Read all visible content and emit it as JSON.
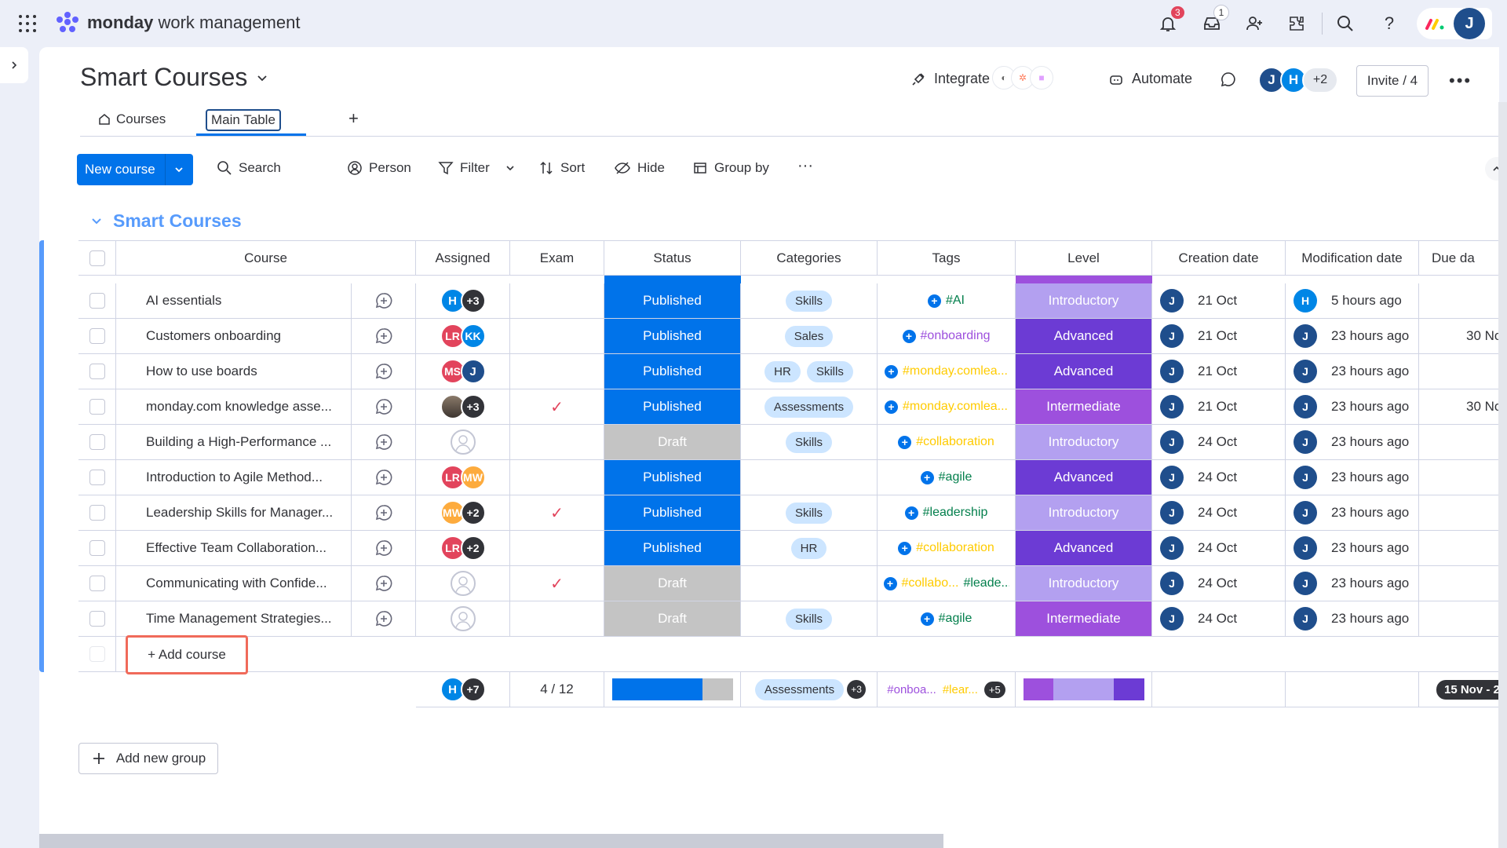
{
  "topbar": {
    "brand_bold": "monday",
    "brand_rest": " work management",
    "notifications_count": "3",
    "inbox_count": "1",
    "user_initial": "J"
  },
  "board": {
    "title": "Smart Courses",
    "integrate_label": "Integrate",
    "automate_label": "Automate",
    "invite_label": "Invite / 4",
    "members_more": "+2",
    "member_j": "J",
    "member_h": "H"
  },
  "tabs": {
    "courses": "Courses",
    "main_table": "Main Table",
    "add": "+"
  },
  "toolbar": {
    "new_course": "New course",
    "search": "Search",
    "person": "Person",
    "filter": "Filter",
    "sort": "Sort",
    "hide": "Hide",
    "group_by": "Group by",
    "more": "···"
  },
  "group": {
    "title": "Smart Courses"
  },
  "columns": {
    "course": "Course",
    "assigned": "Assigned",
    "exam": "Exam",
    "status": "Status",
    "categories": "Categories",
    "tags": "Tags",
    "level": "Level",
    "creation_date": "Creation date",
    "modification_date": "Modification date",
    "due_date": "Due da"
  },
  "colors": {
    "published": "#0073ea",
    "draft": "#c4c4c4",
    "introductory": "#b3a0f0",
    "advanced": "#6c3bd4",
    "intermediate": "#9d50dd",
    "group_blue": "#579bfc"
  },
  "rows": [
    {
      "course": "AI essentials",
      "assigned": [
        "H",
        "+3"
      ],
      "exam": "",
      "status": "Published",
      "categories": [
        "Skills"
      ],
      "tags": [
        "#AI"
      ],
      "tag_color": "#037f4c",
      "level": "Introductory",
      "created": "21 Oct",
      "mod_user": "H",
      "modified": "5 hours ago",
      "due": ""
    },
    {
      "course": "Customers onboarding",
      "assigned": [
        "LR",
        "KK"
      ],
      "exam": "",
      "status": "Published",
      "categories": [
        "Sales"
      ],
      "tags": [
        "#onboarding"
      ],
      "tag_color": "#9d50dd",
      "level": "Advanced",
      "created": "21 Oct",
      "mod_user": "J",
      "modified": "23 hours ago",
      "due": "30 No"
    },
    {
      "course": "How to use boards",
      "assigned": [
        "MS",
        "J"
      ],
      "exam": "",
      "status": "Published",
      "categories": [
        "HR",
        "Skills"
      ],
      "tags": [
        "#monday.comlea..."
      ],
      "tag_color": "#ffcb00",
      "level": "Advanced",
      "created": "21 Oct",
      "mod_user": "J",
      "modified": "23 hours ago",
      "due": ""
    },
    {
      "course": "monday.com knowledge asse...",
      "assigned": [
        "photo",
        "+3"
      ],
      "exam": "✓",
      "status": "Published",
      "categories": [
        "Assessments"
      ],
      "tags": [
        "#monday.comlea..."
      ],
      "tag_color": "#ffcb00",
      "level": "Intermediate",
      "created": "21 Oct",
      "mod_user": "J",
      "modified": "23 hours ago",
      "due": "30 No"
    },
    {
      "course": "Building a High-Performance ...",
      "assigned": [],
      "exam": "",
      "status": "Draft",
      "categories": [
        "Skills"
      ],
      "tags": [
        "#collaboration"
      ],
      "tag_color": "#ffcb00",
      "level": "Introductory",
      "created": "24 Oct",
      "mod_user": "J",
      "modified": "23 hours ago",
      "due": ""
    },
    {
      "course": "Introduction to Agile Method...",
      "assigned": [
        "LR",
        "MW"
      ],
      "exam": "",
      "status": "Published",
      "categories": [],
      "tags": [
        "#agile"
      ],
      "tag_color": "#037f4c",
      "level": "Advanced",
      "created": "24 Oct",
      "mod_user": "J",
      "modified": "23 hours ago",
      "due": ""
    },
    {
      "course": "Leadership Skills for Manager...",
      "assigned": [
        "MW",
        "+2"
      ],
      "exam": "✓",
      "status": "Published",
      "categories": [
        "Skills"
      ],
      "tags": [
        "#leadership"
      ],
      "tag_color": "#037f4c",
      "level": "Introductory",
      "created": "24 Oct",
      "mod_user": "J",
      "modified": "23 hours ago",
      "due": ""
    },
    {
      "course": "Effective Team Collaboration...",
      "assigned": [
        "LR",
        "+2"
      ],
      "exam": "",
      "status": "Published",
      "categories": [
        "HR"
      ],
      "tags": [
        "#collaboration"
      ],
      "tag_color": "#ffcb00",
      "level": "Advanced",
      "created": "24 Oct",
      "mod_user": "J",
      "modified": "23 hours ago",
      "due": ""
    },
    {
      "course": "Communicating with Confide...",
      "assigned": [],
      "exam": "✓",
      "status": "Draft",
      "categories": [],
      "tags": [
        "#collabo...",
        "#leade..."
      ],
      "tag_color": "#ffcb00",
      "level": "Introductory",
      "created": "24 Oct",
      "mod_user": "J",
      "modified": "23 hours ago",
      "due": ""
    },
    {
      "course": "Time Management Strategies...",
      "assigned": [],
      "exam": "",
      "status": "Draft",
      "categories": [
        "Skills"
      ],
      "tags": [
        "#agile"
      ],
      "tag_color": "#037f4c",
      "level": "Intermediate",
      "created": "24 Oct",
      "mod_user": "J",
      "modified": "23 hours ago",
      "due": ""
    }
  ],
  "add_course": "+ Add course",
  "summary": {
    "assigned_more": "+7",
    "exam": "4 / 12",
    "categories_pill": "Assessments",
    "categories_more": "+3",
    "tag1": "#onboa...",
    "tag2": "#lear...",
    "tags_more": "+5",
    "due": "15 Nov - 2",
    "status_published_fraction": 0.75
  },
  "add_new_group": "Add new group"
}
